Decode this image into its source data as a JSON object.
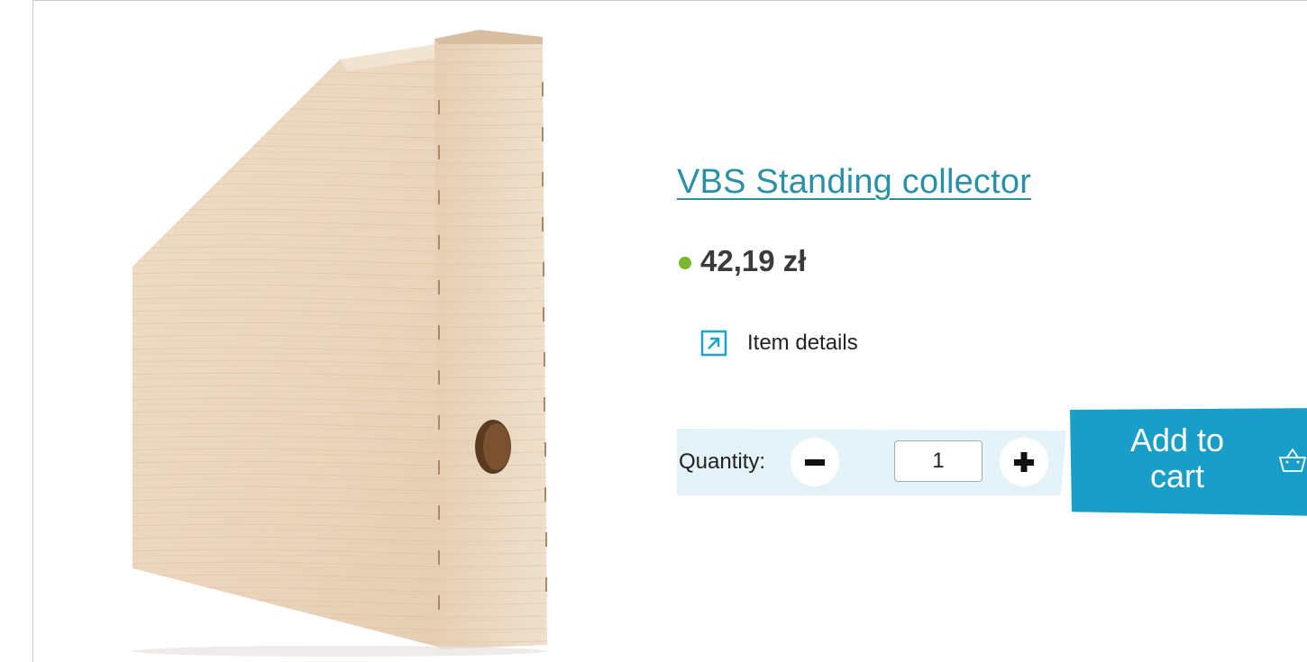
{
  "product": {
    "title": "VBS Standing collector",
    "price": "42,19 zł",
    "stock_status_color": "#7cb82f",
    "details_link": "Item details",
    "details_icon": "external-arrow-icon"
  },
  "quantity": {
    "label": "Quantity:",
    "value": "1",
    "decrease_icon": "minus-icon",
    "increase_icon": "plus-icon"
  },
  "cart": {
    "label_line1": "Add to",
    "label_line2": "cart",
    "icon": "basket-icon"
  },
  "colors": {
    "accent": "#199fc7",
    "title": "#2a90a8",
    "quantity_band": "#e3f3f8"
  }
}
